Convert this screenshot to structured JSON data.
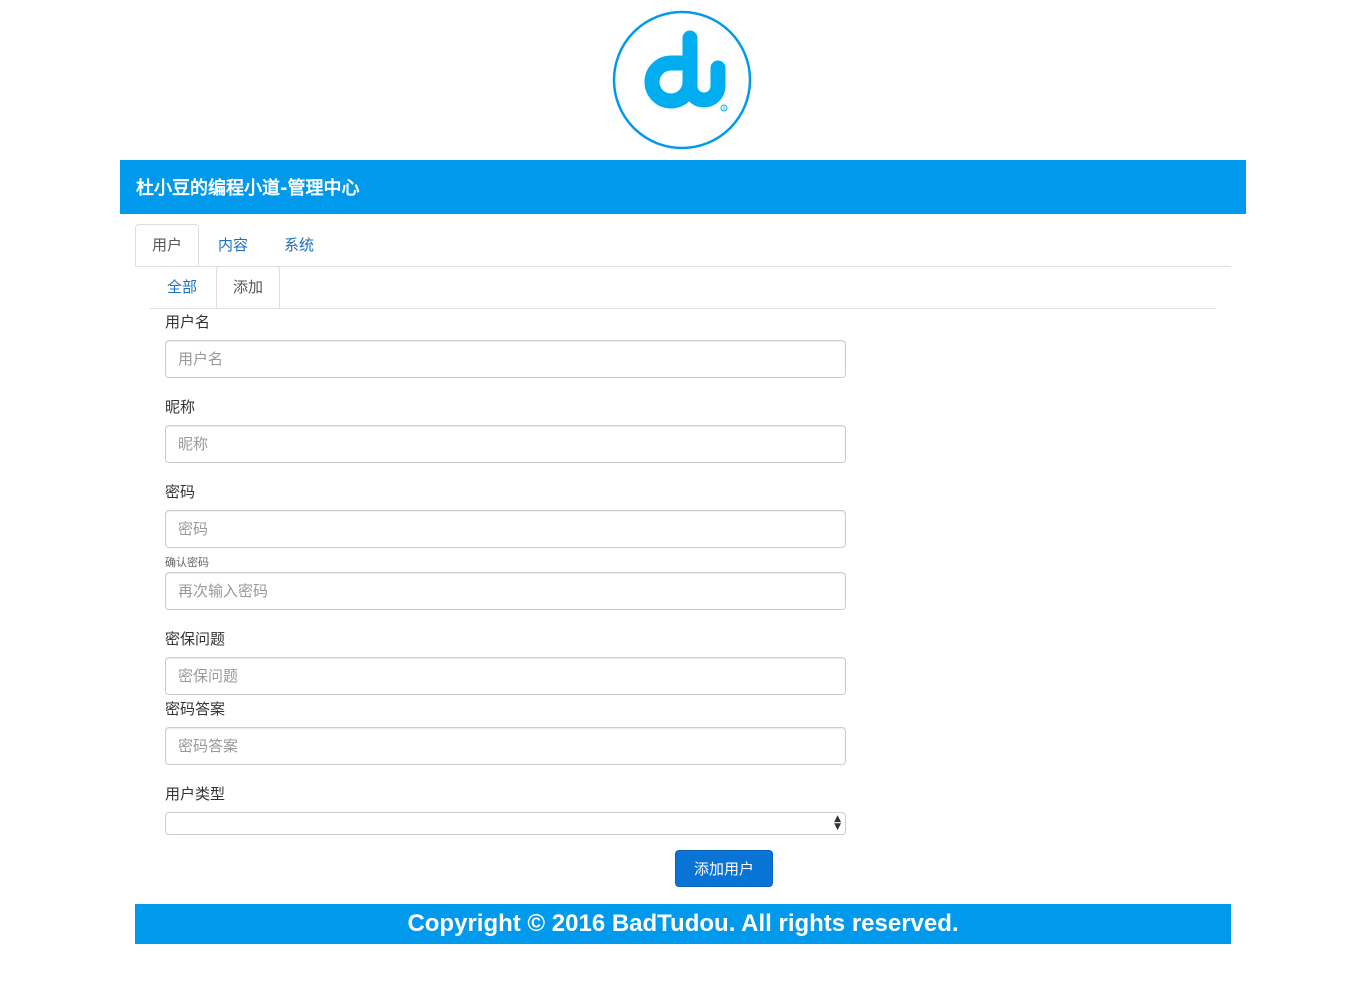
{
  "logo": {
    "text": "du",
    "mark": "®",
    "ring_color": "#0099ec",
    "glyph_color": "#00aeef"
  },
  "header": {
    "title": "杜小豆的编程小道-管理中心",
    "background": "#0099ec"
  },
  "tabs_main": [
    {
      "label": "用户",
      "active": true
    },
    {
      "label": "内容",
      "active": false
    },
    {
      "label": "系统",
      "active": false
    }
  ],
  "tabs_sub": [
    {
      "label": "全部",
      "active": false
    },
    {
      "label": "添加",
      "active": true
    }
  ],
  "form": {
    "username": {
      "label": "用户名",
      "placeholder": "用户名",
      "value": ""
    },
    "nickname": {
      "label": "昵称",
      "placeholder": "昵称",
      "value": ""
    },
    "password": {
      "label": "密码",
      "placeholder": "密码",
      "value": ""
    },
    "confirm_password": {
      "label": "确认密码",
      "placeholder": "再次输入密码",
      "value": ""
    },
    "security_question": {
      "label": "密保问题",
      "placeholder": "密保问题",
      "value": ""
    },
    "security_answer": {
      "label": "密码答案",
      "placeholder": "密码答案",
      "value": ""
    },
    "user_type": {
      "label": "用户类型",
      "selected": ""
    },
    "submit_label": "添加用户"
  },
  "footer": {
    "text": "Copyright © 2016 BadTudou. All rights reserved.",
    "background": "#0099ec"
  },
  "colors": {
    "accent": "#0099ec",
    "button": "#0a73d6",
    "link": "#1a6fbf"
  }
}
